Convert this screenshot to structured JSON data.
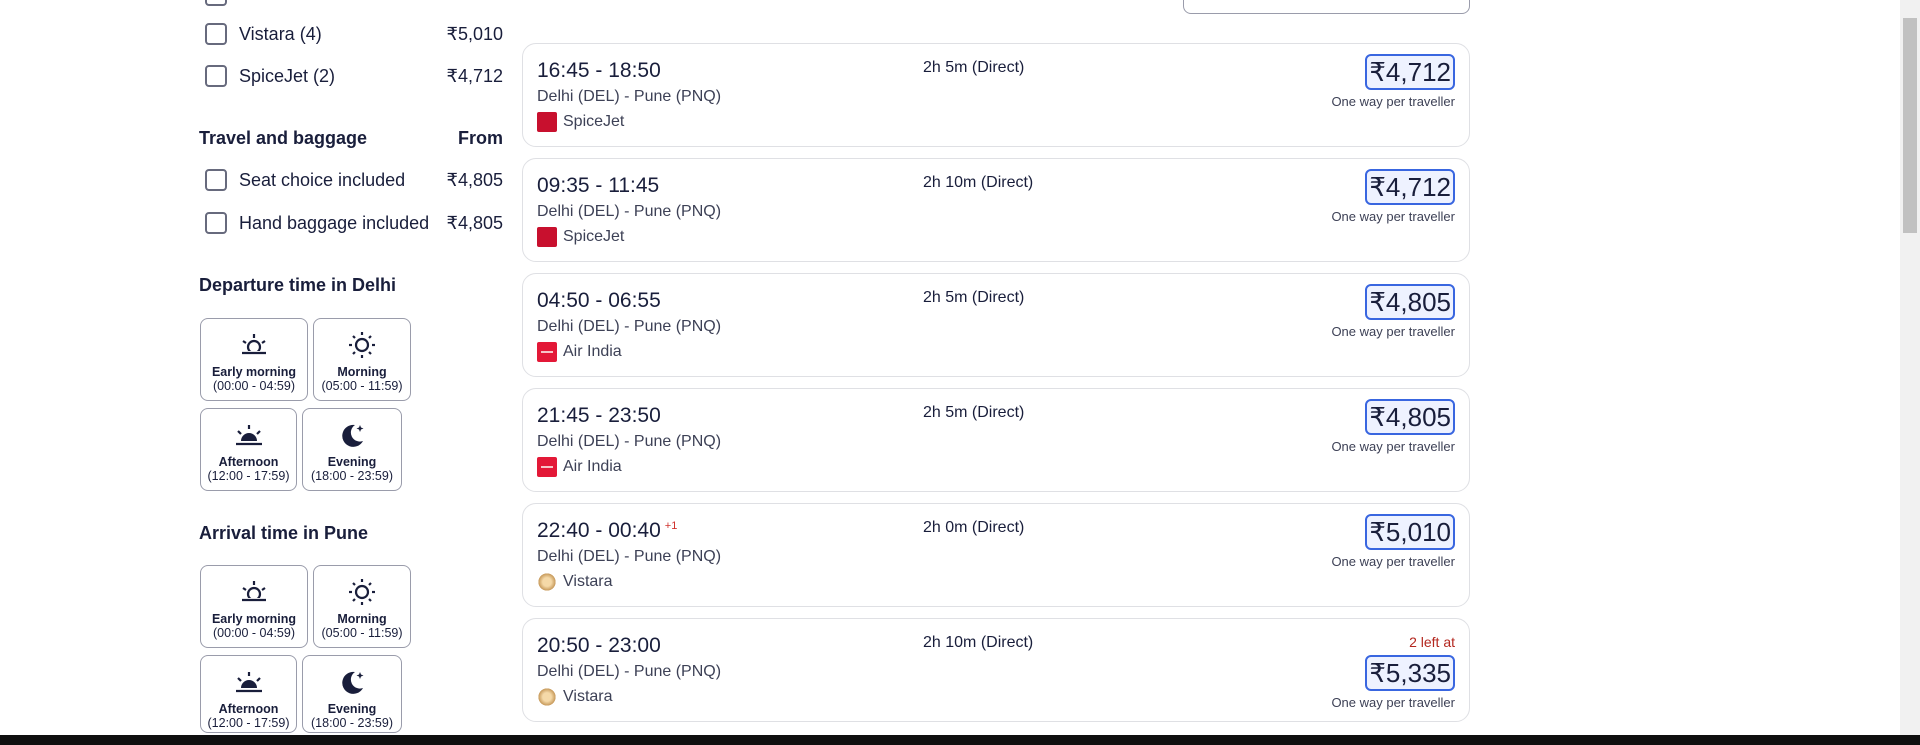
{
  "filters": {
    "airlines": [
      {
        "label": "Vistara (4)",
        "price": "₹5,010"
      },
      {
        "label": "SpiceJet (2)",
        "price": "₹4,712"
      }
    ],
    "baggage": {
      "title": "Travel and baggage",
      "from_label": "From",
      "items": [
        {
          "label": "Seat choice included",
          "price": "₹4,805"
        },
        {
          "label": "Hand baggage included",
          "price": "₹4,805"
        }
      ]
    },
    "departure": {
      "title": "Departure time in Delhi",
      "tiles": [
        {
          "name": "Early morning",
          "range": "(00:00 - 04:59)",
          "icon": "sunrise-icon"
        },
        {
          "name": "Morning",
          "range": "(05:00 - 11:59)",
          "icon": "sun-icon"
        },
        {
          "name": "Afternoon",
          "range": "(12:00 - 17:59)",
          "icon": "sunset-icon"
        },
        {
          "name": "Evening",
          "range": "(18:00 - 23:59)",
          "icon": "moon-icon"
        }
      ]
    },
    "arrival": {
      "title": "Arrival time in Pune",
      "tiles": [
        {
          "name": "Early morning",
          "range": "(00:00 - 04:59)",
          "icon": "sunrise-icon"
        },
        {
          "name": "Morning",
          "range": "(05:00 - 11:59)",
          "icon": "sun-icon"
        },
        {
          "name": "Afternoon",
          "range": "(12:00 - 17:59)",
          "icon": "sunset-icon"
        },
        {
          "name": "Evening",
          "range": "(18:00 - 23:59)",
          "icon": "moon-icon"
        }
      ]
    }
  },
  "results": [
    {
      "times": "16:45 - 18:50",
      "next_day": "",
      "route": "Delhi (DEL) - Pune (PNQ)",
      "airline": "SpiceJet",
      "logo": "spicejet",
      "duration": "2h 5m (Direct)",
      "price": "₹4,712",
      "per": "One way per traveller",
      "left_at": ""
    },
    {
      "times": "09:35 - 11:45",
      "next_day": "",
      "route": "Delhi (DEL) - Pune (PNQ)",
      "airline": "SpiceJet",
      "logo": "spicejet",
      "duration": "2h 10m (Direct)",
      "price": "₹4,712",
      "per": "One way per traveller",
      "left_at": ""
    },
    {
      "times": "04:50 - 06:55",
      "next_day": "",
      "route": "Delhi (DEL) - Pune (PNQ)",
      "airline": "Air India",
      "logo": "airindia",
      "duration": "2h 5m (Direct)",
      "price": "₹4,805",
      "per": "One way per traveller",
      "left_at": ""
    },
    {
      "times": "21:45 - 23:50",
      "next_day": "",
      "route": "Delhi (DEL) - Pune (PNQ)",
      "airline": "Air India",
      "logo": "airindia",
      "duration": "2h 5m (Direct)",
      "price": "₹4,805",
      "per": "One way per traveller",
      "left_at": ""
    },
    {
      "times": "22:40 - 00:40",
      "next_day": "+1",
      "route": "Delhi (DEL) - Pune (PNQ)",
      "airline": "Vistara",
      "logo": "vistara",
      "duration": "2h 0m (Direct)",
      "price": "₹5,010",
      "per": "One way per traveller",
      "left_at": ""
    },
    {
      "times": "20:50 - 23:00",
      "next_day": "",
      "route": "Delhi (DEL) - Pune (PNQ)",
      "airline": "Vistara",
      "logo": "vistara",
      "duration": "2h 10m (Direct)",
      "price": "₹5,335",
      "per": "One way per traveller",
      "left_at": "2 left at"
    }
  ]
}
